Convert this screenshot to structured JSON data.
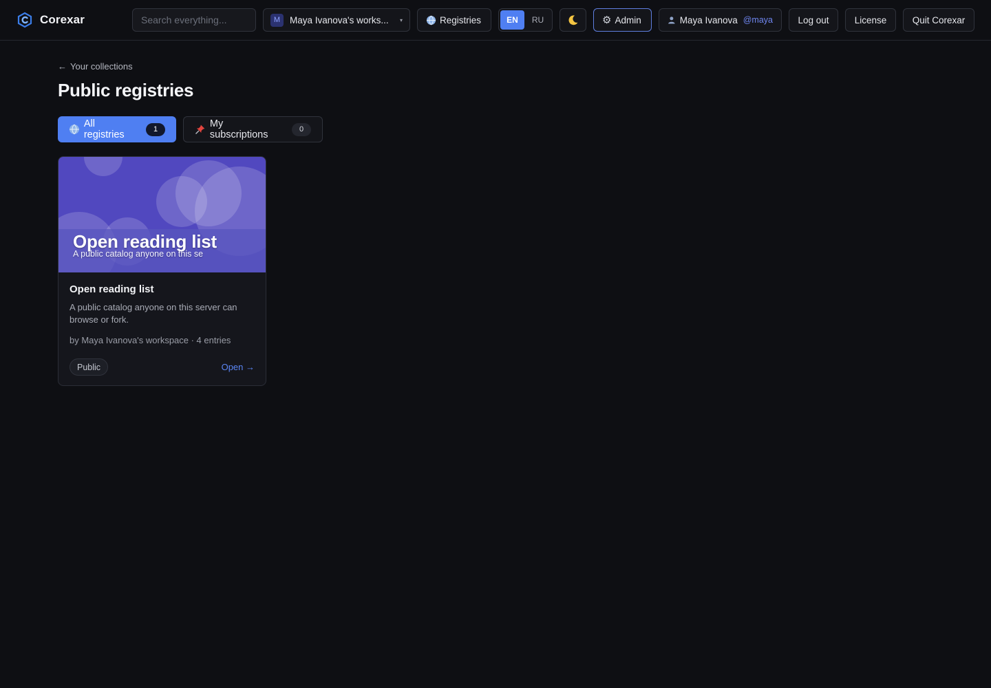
{
  "app": {
    "name": "Corexar"
  },
  "topbar": {
    "search_placeholder": "Search everything...",
    "workspace": {
      "initial": "M",
      "label": "Maya Ivanova's works..."
    },
    "registries_label": "Registries",
    "languages": [
      "EN",
      "RU"
    ],
    "active_language": "EN",
    "theme_icon": "moon-icon",
    "admin_label": "Admin",
    "user": {
      "name": "Maya Ivanova",
      "handle": "@maya"
    },
    "logout_label": "Log out",
    "license_label": "License",
    "quit_label": "Quit Corexar"
  },
  "page": {
    "back_label": "Your collections",
    "title": "Public registries",
    "tabs": [
      {
        "label": "All registries",
        "count": "1",
        "icon": "globe-icon",
        "active": true
      },
      {
        "label": "My subscriptions",
        "count": "0",
        "icon": "pin-icon",
        "active": false
      }
    ]
  },
  "registries": [
    {
      "cover_title": "Open reading list",
      "cover_subtitle": "A public catalog anyone on this se",
      "name": "Open reading list",
      "description": "A public catalog anyone on this server can browse or fork.",
      "meta": "by Maya Ivanova's workspace · 4 entries",
      "visibility": "Public",
      "open_label": "Open →"
    }
  ],
  "colors": {
    "background": "#0e0f13",
    "accent": "#4f7ff2",
    "cover": "#5148bf",
    "link": "#5b86f5"
  }
}
